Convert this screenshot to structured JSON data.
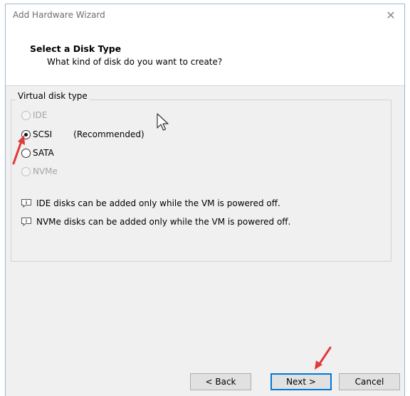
{
  "window": {
    "title": "Add Hardware Wizard",
    "close_glyph": "✕"
  },
  "header": {
    "title": "Select a Disk Type",
    "subtitle": "What kind of disk do you want to create?"
  },
  "group": {
    "label": "Virtual disk type"
  },
  "options": [
    {
      "label": "IDE",
      "checked": false,
      "enabled": false
    },
    {
      "label": "SCSI",
      "checked": true,
      "enabled": true,
      "note": "(Recommended)"
    },
    {
      "label": "SATA",
      "checked": false,
      "enabled": true
    },
    {
      "label": "NVMe",
      "checked": false,
      "enabled": false
    }
  ],
  "info": [
    "IDE disks can be added only while the VM is powered off.",
    "NVMe disks can be added only while the VM is powered off."
  ],
  "buttons": {
    "back": "< Back",
    "next": "Next >",
    "cancel": "Cancel"
  },
  "colors": {
    "annotation_arrow": "#e03a3a",
    "accent": "#0078d7"
  }
}
